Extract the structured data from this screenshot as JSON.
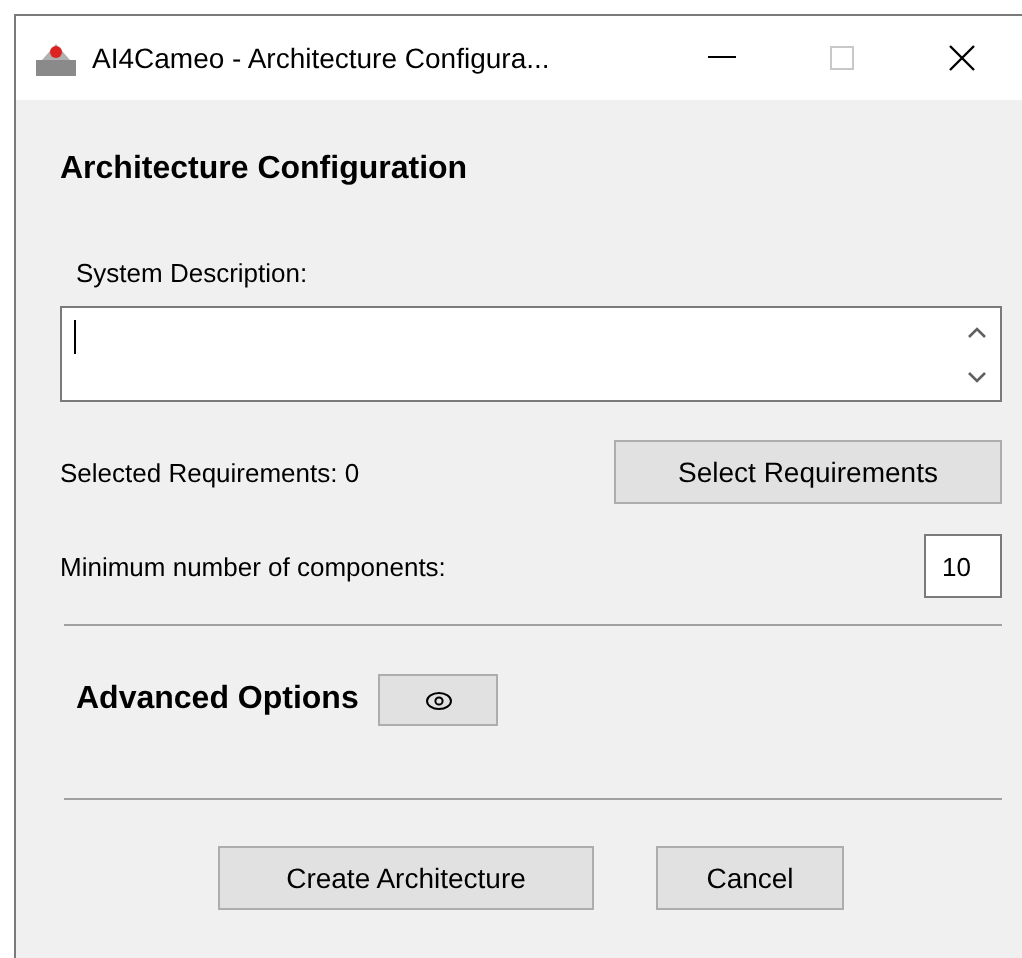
{
  "window": {
    "title": "AI4Cameo - Architecture Configura..."
  },
  "heading": "Architecture Configuration",
  "description": {
    "label": "System Description:"
  },
  "requirements": {
    "label": "Selected Requirements: 0",
    "button": "Select Requirements"
  },
  "components": {
    "label": "Minimum number of components:",
    "value": "10"
  },
  "advanced": {
    "label": "Advanced Options",
    "expanded": false
  },
  "buttons": [
    "Create Architecture",
    "Cancel"
  ]
}
